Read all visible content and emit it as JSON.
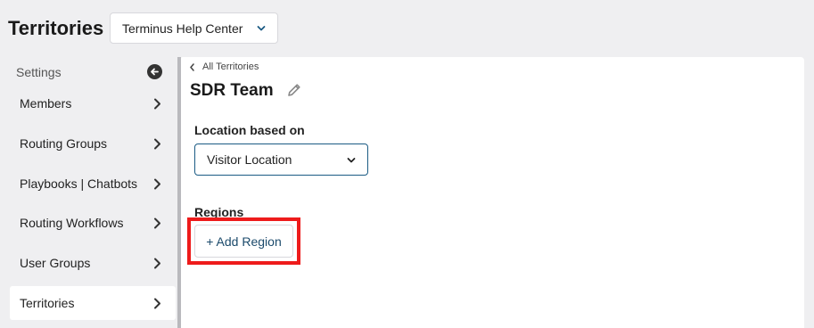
{
  "header": {
    "title": "Territories",
    "workspace_select": "Terminus Help Center"
  },
  "sidebar": {
    "header": "Settings",
    "items": [
      {
        "label": "Members"
      },
      {
        "label": "Routing Groups"
      },
      {
        "label": "Playbooks | Chatbots"
      },
      {
        "label": "Routing Workflows"
      },
      {
        "label": "User Groups"
      },
      {
        "label": "Territories",
        "active": true
      }
    ]
  },
  "main": {
    "breadcrumb": "All Territories",
    "title": "SDR Team",
    "location_label": "Location based on",
    "location_value": "Visitor Location",
    "regions_label": "Regions",
    "add_region_label": "+ Add Region"
  },
  "colors": {
    "accent": "#1b5b84",
    "highlight": "#ee1b1b",
    "background": "#efeff1"
  },
  "icons": [
    "chevron-down-icon",
    "back-arrow-icon",
    "chevron-right-icon",
    "chevron-left-icon",
    "pencil-icon"
  ]
}
